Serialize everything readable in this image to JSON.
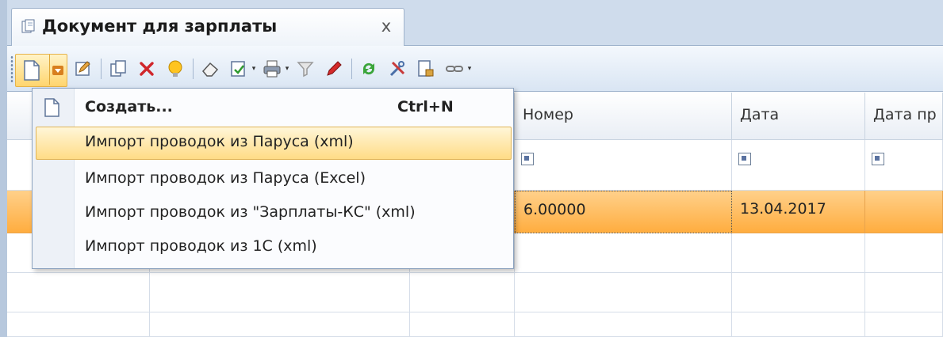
{
  "tab": {
    "title": "Документ для зарплаты",
    "close": "x"
  },
  "grid": {
    "columns": [
      "Номер",
      "Дата",
      "Дата пр"
    ],
    "row": {
      "number": "6.00000",
      "date": "13.04.2017"
    }
  },
  "menu": {
    "items": [
      {
        "label": "Создать...",
        "shortcut": "Ctrl+N"
      },
      {
        "label": "Импорт проводок из Паруса (xml)"
      },
      {
        "label": "Импорт проводок из Паруса (Excel)"
      },
      {
        "label": "Импорт проводок из \"Зарплаты-КС\" (xml)"
      },
      {
        "label": "Импорт проводок из 1С (xml)"
      }
    ]
  },
  "colors": {
    "highlight": "#ffd56e",
    "selected_row": "#ffad3f",
    "frame": "#cfdcec"
  }
}
